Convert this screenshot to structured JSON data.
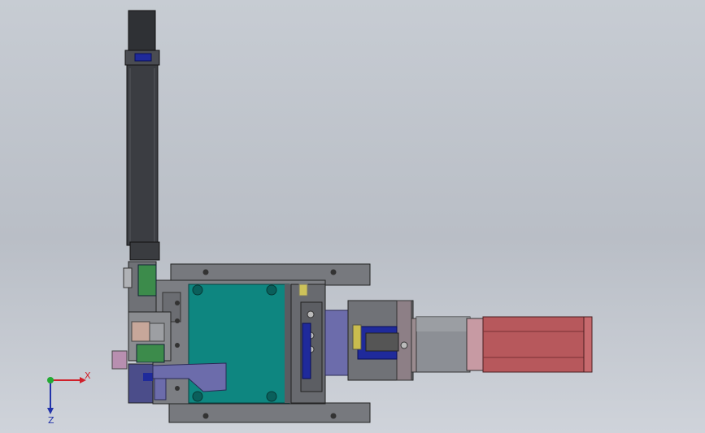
{
  "viewport": {
    "background_top": "#c7ccd3",
    "background_bottom": "#cfd3da"
  },
  "model": {
    "colors": {
      "dark_metal": "#3b3d42",
      "gray_plate": "#77797e",
      "teal_plate": "#0e8680",
      "green_block": "#3c8b4b",
      "blue_parts": "#1f2a9b",
      "purple_parts": "#6c6cab",
      "motor_red": "#b7585c",
      "motor_gray": "#8c8f95",
      "pink_flange": "#c79aa3",
      "yellow_tab": "#cdc25a"
    },
    "parts": [
      "vertical-rail-actuator",
      "base-plate",
      "teal-mounting-plate",
      "linear-slide",
      "coupling",
      "servo-motor",
      "clamp-assembly"
    ]
  },
  "triad": {
    "icon": "coordinate-triad-icon",
    "x_label": "X",
    "z_label": "Z",
    "x_color": "#d0202a",
    "z_color": "#2233aa",
    "y_color": "#22aa33"
  }
}
